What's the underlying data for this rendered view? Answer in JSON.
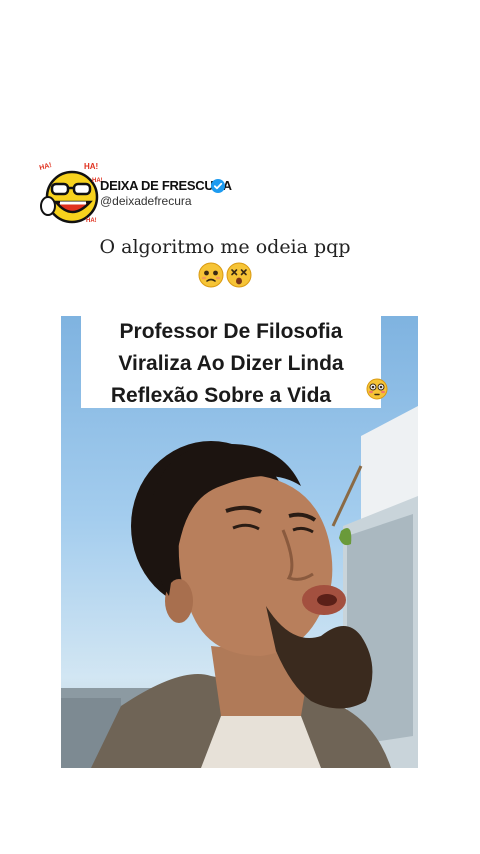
{
  "header": {
    "brand_name": "DEIXA DE FRESCURA",
    "handle": "@deixadefrecura",
    "logo_lettering": [
      "HA!",
      "HA!",
      "HA!",
      "HA!"
    ],
    "verified_badge_icon": "verified-check-icon",
    "colors": {
      "verified": "#1d9bf0",
      "logo_yellow": "#f7d21d",
      "logo_red": "#e0301e"
    }
  },
  "post": {
    "caption": "O algoritmo me odeia pqp",
    "caption_emojis": [
      "pleading-face-icon",
      "dizzy-face-icon"
    ]
  },
  "video": {
    "overlay_lines": [
      "Professor De Filosofia",
      "Viraliza Ao Dizer Linda",
      "Reflexão Sobre a Vida"
    ],
    "overlay_emoji": "flushed-face-icon"
  }
}
